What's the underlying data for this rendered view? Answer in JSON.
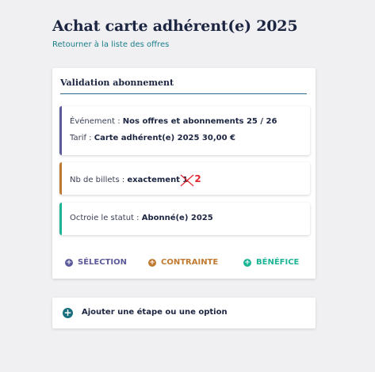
{
  "page": {
    "title": "Achat carte adhérent(e) 2025",
    "back_link": "Retourner à la liste des offres"
  },
  "card": {
    "title": "Validation abonnement",
    "event_label": "Événement :",
    "event_value": "Nos offres et abonnements 25 / 26",
    "tarif_label": "Tarif :",
    "tarif_value": "Carte adhérent(e) 2025 30,00 €",
    "tickets_label": "Nb de billets :",
    "tickets_value": "exactement",
    "tickets_old": "1",
    "tickets_new": "2",
    "status_label": "Octroie le statut :",
    "status_value": "Abonné(e) 2025"
  },
  "actions": {
    "selection": "SÉLECTION",
    "contrainte": "CONTRAINTE",
    "benefice": "BÉNÉFICE"
  },
  "add_step": {
    "label": "Ajouter une étape ou une option"
  },
  "colors": {
    "selection": "#5c5a9a",
    "contrainte": "#c07a30",
    "benefice": "#1bb494",
    "link": "#1a7d8a",
    "correction": "#e0262e"
  },
  "icons": {
    "add": "plus-circle-icon",
    "strike": "cross-out-icon"
  }
}
